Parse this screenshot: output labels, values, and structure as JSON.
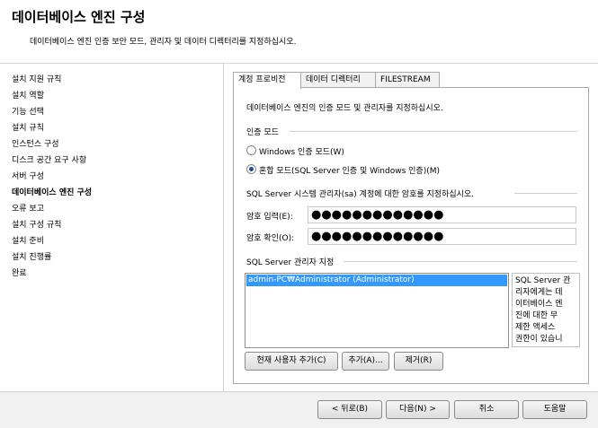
{
  "header": {
    "title": "데이터베이스 엔진 구성",
    "subtitle": "데이터베이스 엔진 인증 보안 모드, 관리자 및 데이터 디렉터리를 지정하십시오."
  },
  "nav": {
    "items": [
      "설치 지원 규칙",
      "설치 역할",
      "기능 선택",
      "설치 규칙",
      "인스턴스 구성",
      "디스크 공간 요구 사항",
      "서버 구성",
      "데이터베이스 엔진 구성",
      "오류 보고",
      "설치 구성 규칙",
      "설치 준비",
      "설치 진행률",
      "완료"
    ],
    "active_index": 7
  },
  "tabs": [
    "계정 프로비전",
    "데이터 디렉터리",
    "FILESTREAM"
  ],
  "panel": {
    "description": "데이터베이스 엔진의 인증 모드 및 관리자를 지정하십시오.",
    "auth_mode_label": "인증 모드",
    "radio_windows": "Windows 인증 모드(W)",
    "radio_mixed": "혼합 모드(SQL Server 인증 및 Windows 인증)(M)",
    "selected_auth": "mixed",
    "sa_prompt": "SQL Server 시스템 관리자(sa) 계정에 대한 암호를 지정하십시오.",
    "password_label": "암호 입력(E):",
    "password_value": "●●●●●●●●●●●●●",
    "confirm_label": "암호 확인(O):",
    "confirm_value": "●●●●●●●●●●●●●",
    "admins_label": "SQL Server 관리자 지정",
    "admins": [
      "admin-PC₩Administrator (Administrator)"
    ],
    "admins_note_lines": [
      "SQL Server 관",
      "리자에게는 데",
      "이터베이스 엔",
      "진에 대한 무",
      "제한 액세스",
      "권한이 있습니"
    ],
    "btn_add_current": "현재 사용자 추가(C)",
    "btn_add": "추가(A)...",
    "btn_remove": "제거(R)"
  },
  "footer": {
    "back": "< 뒤로(B)",
    "next": "다음(N) >",
    "cancel": "취소",
    "help": "도움말"
  }
}
